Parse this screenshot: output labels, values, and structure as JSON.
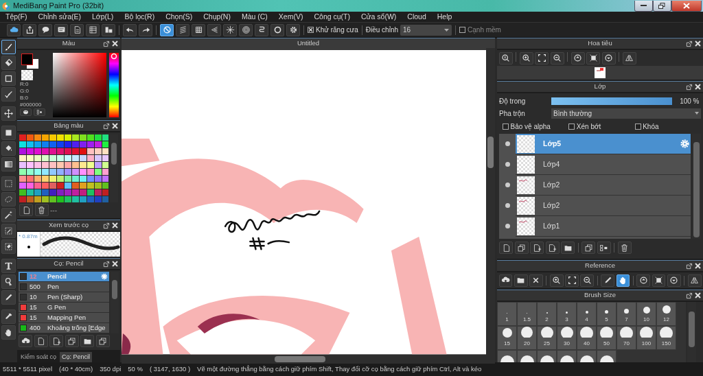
{
  "window": {
    "title": "MediBang Paint Pro (32bit)"
  },
  "menu": [
    "Tệp(F)",
    "Chỉnh sửa(E)",
    "Lớp(L)",
    "Bộ lọc(R)",
    "Chọn(S)",
    "Chụp(N)",
    "Màu (C)",
    "Xem(V)",
    "Công cụ(T)",
    "Cửa sổ(W)",
    "Cloud",
    "Help"
  ],
  "toolbar": {
    "snap_modes": [
      {
        "selected": true
      },
      {
        "selected": false
      },
      {
        "selected": false
      },
      {
        "selected": false
      },
      {
        "selected": false
      },
      {
        "selected": false
      },
      {
        "selected": false
      },
      {
        "selected": false
      },
      {
        "selected": false
      }
    ],
    "antialias": {
      "label": "Khử răng cưa",
      "checked": true
    },
    "adjust": {
      "label": "Điều chỉnh",
      "value": "16"
    },
    "soft_edge": {
      "label": "Cạnh mềm",
      "checked": false
    }
  },
  "tools": [
    {
      "selected": true
    },
    {
      "selected": false
    },
    {
      "selected": false
    },
    {
      "selected": false
    },
    {
      "selected": false
    },
    {
      "selected": false
    },
    {
      "selected": false
    },
    {
      "selected": false
    },
    {
      "selected": false
    },
    {
      "selected": false
    },
    {
      "selected": false
    },
    {
      "selected": false
    },
    {
      "selected": false
    },
    {
      "selected": false
    },
    {
      "selected": false
    },
    {
      "selected": false
    },
    {
      "selected": false
    },
    {
      "selected": false
    }
  ],
  "color_panel": {
    "title": "Màu",
    "r": "R:0",
    "g": "G:0",
    "b": "B:0",
    "hex": "#000000",
    "hue": {
      "level": 1.0
    }
  },
  "palette_panel": {
    "title": "Bảng màu",
    "footer": "---",
    "swatches": [
      {
        "color": "#e02020"
      },
      {
        "color": "#f05a10"
      },
      {
        "color": "#f58a10"
      },
      {
        "color": "#f5a500"
      },
      {
        "color": "#f5c800"
      },
      {
        "color": "#f0e000"
      },
      {
        "color": "#d8f000"
      },
      {
        "color": "#a8e820"
      },
      {
        "color": "#80e020"
      },
      {
        "color": "#50e020"
      },
      {
        "color": "#20e040"
      },
      {
        "color": "#20e080"
      },
      {
        "color": "#10e0e0"
      },
      {
        "color": "#10c0f0"
      },
      {
        "color": "#10a0f0"
      },
      {
        "color": "#1080f0"
      },
      {
        "color": "#1060f0"
      },
      {
        "color": "#1040f0"
      },
      {
        "color": "#2020f0"
      },
      {
        "color": "#5020f0"
      },
      {
        "color": "#8020f0"
      },
      {
        "color": "#a020f0"
      },
      {
        "color": "#c020e0"
      },
      {
        "color": "#20f040"
      },
      {
        "color": "#b010e0"
      },
      {
        "color": "#d010e0"
      },
      {
        "color": "#e010d0"
      },
      {
        "color": "#e010b0"
      },
      {
        "color": "#e01090"
      },
      {
        "color": "#e01070"
      },
      {
        "color": "#e01050"
      },
      {
        "color": "#e01030"
      },
      {
        "color": "#e01010"
      },
      {
        "color": "#ffc0c0"
      },
      {
        "color": "#ffd0c0"
      },
      {
        "color": "#ffe0c0"
      },
      {
        "color": "#fff0c0"
      },
      {
        "color": "#f8ffc0"
      },
      {
        "color": "#e8ffc0"
      },
      {
        "color": "#d8ffc8"
      },
      {
        "color": "#c8ffd8"
      },
      {
        "color": "#c8ffe8"
      },
      {
        "color": "#c8f8ff"
      },
      {
        "color": "#c8e8ff"
      },
      {
        "color": "#c8d8ff"
      },
      {
        "color": "#ffb0c8"
      },
      {
        "color": "#d8c8ff"
      },
      {
        "color": "#e8c8ff"
      },
      {
        "color": "#e8c0ff"
      },
      {
        "color": "#ffc0ff"
      },
      {
        "color": "#ffc0e8"
      },
      {
        "color": "#ffc0d0"
      },
      {
        "color": "#ffc0c1"
      },
      {
        "color": "#ffc8b0"
      },
      {
        "color": "#ffa8a8"
      },
      {
        "color": "#ffc090"
      },
      {
        "color": "#ffe890"
      },
      {
        "color": "#f0ff90"
      },
      {
        "color": "#c0a0ff"
      },
      {
        "color": "#d0ff90"
      },
      {
        "color": "#90ffb0"
      },
      {
        "color": "#90ffd0"
      },
      {
        "color": "#90fff0"
      },
      {
        "color": "#90e8ff"
      },
      {
        "color": "#90c8ff"
      },
      {
        "color": "#90b0ff"
      },
      {
        "color": "#a090ff"
      },
      {
        "color": "#d090ff"
      },
      {
        "color": "#ff90ff"
      },
      {
        "color": "#ff90d0"
      },
      {
        "color": "#80ff80"
      },
      {
        "color": "#ffa0d0"
      },
      {
        "color": "#ff9090"
      },
      {
        "color": "#ff7070"
      },
      {
        "color": "#ffb070"
      },
      {
        "color": "#ffd070"
      },
      {
        "color": "#f0f070"
      },
      {
        "color": "#c0f070"
      },
      {
        "color": "#80f0a0"
      },
      {
        "color": "#70f0d0"
      },
      {
        "color": "#70f0f0"
      },
      {
        "color": "#7090ff"
      },
      {
        "color": "#9070ff"
      },
      {
        "color": "#c070ff"
      },
      {
        "color": "#e060ff"
      },
      {
        "color": "#ff60e0"
      },
      {
        "color": "#ff6090"
      },
      {
        "color": "#ff6060"
      },
      {
        "color": "#e06060"
      },
      {
        "color": "#d02020"
      },
      {
        "color": "#60c0ff"
      },
      {
        "color": "#e06020"
      },
      {
        "color": "#e0a020"
      },
      {
        "color": "#c0c020"
      },
      {
        "color": "#a0c020"
      },
      {
        "color": "#60c020"
      },
      {
        "color": "#40c020"
      },
      {
        "color": "#20c0a0"
      },
      {
        "color": "#20a0c0"
      },
      {
        "color": "#2060c0"
      },
      {
        "color": "#4020c0"
      },
      {
        "color": "#8020c0"
      },
      {
        "color": "#a020c0"
      },
      {
        "color": "#c020a0"
      },
      {
        "color": "#c02080"
      },
      {
        "color": "#20c060"
      },
      {
        "color": "#c02060"
      },
      {
        "color": "#c02021"
      },
      {
        "color": "#c02022"
      },
      {
        "color": "#c06020"
      },
      {
        "color": "#c0a020"
      },
      {
        "color": "#a0c021"
      },
      {
        "color": "#60c021"
      },
      {
        "color": "#20c020"
      },
      {
        "color": "#20c061"
      },
      {
        "color": "#20c0a1"
      },
      {
        "color": "#20a0c1"
      },
      {
        "color": "#2060c1"
      },
      {
        "color": "#2040c0"
      },
      {
        "color": "#2060a0"
      }
    ]
  },
  "brush_preview": {
    "title": "Xem trước cọ",
    "size": "* 0.87m"
  },
  "brush_panel": {
    "title": "Cọ: Pencil",
    "brushes": [
      {
        "size": "12",
        "name": "Pencil",
        "color": "#303030",
        "selected": true
      },
      {
        "size": "500",
        "name": "Pen",
        "color": "#303030",
        "selected": false
      },
      {
        "size": "10",
        "name": "Pen (Sharp)",
        "color": "#303030",
        "selected": false
      },
      {
        "size": "15",
        "name": "G Pen",
        "color": "#f03c3c",
        "selected": false
      },
      {
        "size": "15",
        "name": "Mapping Pen",
        "color": "#f03c3c",
        "selected": false
      },
      {
        "size": "400",
        "name": "Khoảng trống [Edge",
        "color": "#18b818",
        "selected": false
      }
    ]
  },
  "left_tabs": [
    {
      "label": "Kiểm soát cọ",
      "selected": false
    },
    {
      "label": "Cọ: Pencil",
      "selected": true
    }
  ],
  "canvas": {
    "tab": "Untitled"
  },
  "navigator": {
    "title": "Hoa tiêu"
  },
  "layer_panel": {
    "title": "Lớp",
    "opacity_label": "Độ trong",
    "opacity": {
      "level": 1.0
    },
    "opacity_reading": "100 %",
    "blend_label": "Pha trộn",
    "blend_value": "Bình thường",
    "options": [
      {
        "label": "Bảo vệ alpha",
        "checked": false
      },
      {
        "label": "Xén bớt",
        "checked": false
      },
      {
        "label": "Khóa",
        "checked": false
      }
    ],
    "layers": [
      {
        "name": "Lớp5",
        "kind": "empty",
        "selected": true
      },
      {
        "name": "Lớp4",
        "kind": "empty",
        "selected": false
      },
      {
        "name": "Lớp2",
        "kind": "sketch",
        "selected": false
      },
      {
        "name": "Lớp2",
        "kind": "sketch",
        "selected": false
      },
      {
        "name": "Lớp1",
        "kind": "sketch",
        "selected": false
      }
    ]
  },
  "reference": {
    "title": "Reference",
    "tools": [
      {
        "selected": false
      },
      {
        "selected": false
      },
      {
        "selected": false
      },
      {
        "selected": false
      },
      {
        "selected": false
      },
      {
        "selected": false
      },
      {
        "selected": false
      },
      {
        "selected": true
      },
      {
        "selected": false
      },
      {
        "selected": false
      },
      {
        "selected": false
      },
      {
        "selected": false
      }
    ]
  },
  "brush_size": {
    "title": "Brush Size",
    "sizes": [
      "1",
      "1.5",
      "2",
      "3",
      "4",
      "5",
      "7",
      "10",
      "12",
      "15",
      "20",
      "25",
      "30",
      "40",
      "50",
      "70",
      "100",
      "150"
    ]
  },
  "status_bar": [
    "5511 * 5511 pixel",
    "(40 * 40cm)",
    "350 dpi",
    "50 %",
    "( 3147, 1630 )",
    "Vẽ một đường thẳng bằng cách giữ phím Shift, Thay đổi cỡ cọ bằng cách giữ phím Ctrl, Alt và kéo"
  ]
}
